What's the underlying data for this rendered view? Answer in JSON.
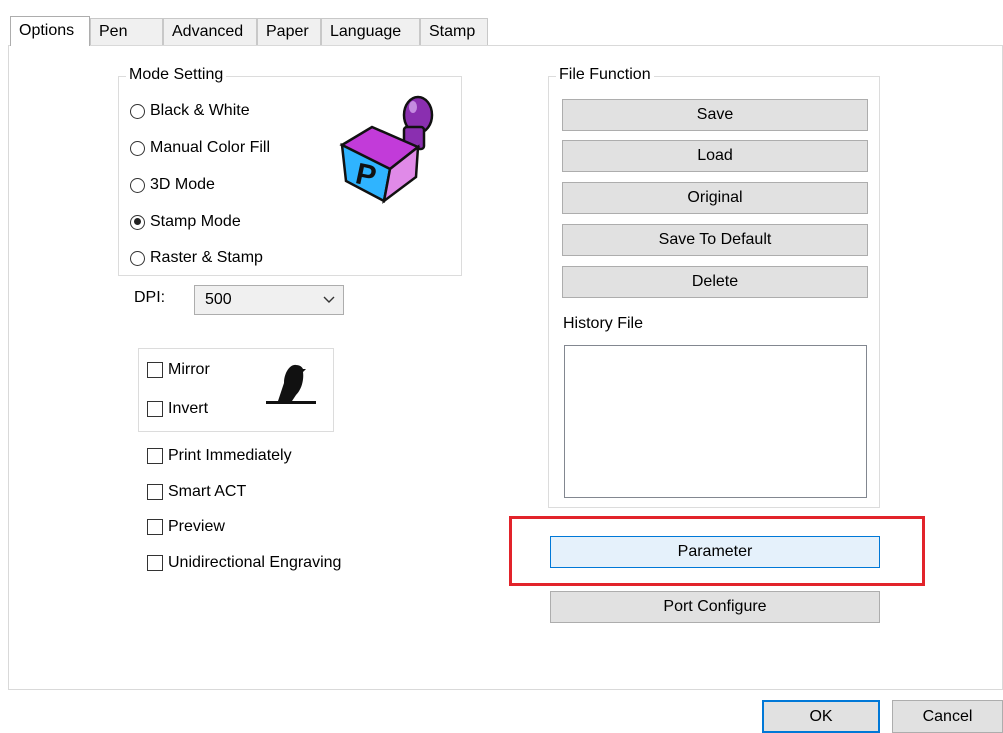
{
  "tabs": [
    "Options",
    "Pen",
    "Advanced",
    "Paper",
    "Language",
    "Stamp"
  ],
  "mode_setting": {
    "title": "Mode Setting",
    "options": [
      "Black & White",
      "Manual Color Fill",
      "3D Mode",
      "Stamp Mode",
      "Raster & Stamp"
    ],
    "selected": "Stamp Mode"
  },
  "dpi": {
    "label": "DPI:",
    "value": "500"
  },
  "image_options": {
    "mirror": "Mirror",
    "invert": "Invert"
  },
  "checkboxes": [
    "Print Immediately",
    "Smart ACT",
    "Preview",
    "Unidirectional Engraving"
  ],
  "file_function": {
    "title": "File Function",
    "buttons": [
      "Save",
      "Load",
      "Original",
      "Save To Default",
      "Delete"
    ],
    "history_label": "History File"
  },
  "parameter_button": "Parameter",
  "port_configure_button": "Port Configure",
  "footer": {
    "ok": "OK",
    "cancel": "Cancel"
  },
  "colors": {
    "highlight_box": "#e2232a",
    "accent": "#0078d7"
  }
}
